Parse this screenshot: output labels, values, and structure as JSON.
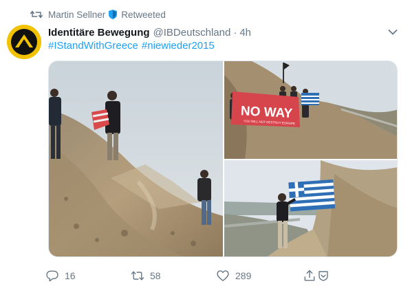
{
  "retweet_banner": {
    "user": "Martin Sellner",
    "label": "Retweeted",
    "icon": "retweet-icon",
    "badge_icon": "shield-icon"
  },
  "author": {
    "name": "Identitäre Bewegung",
    "handle": "@IBDeutschland",
    "separator": "·",
    "time": "4h",
    "avatar_icon": "lambda-logo-avatar"
  },
  "tweet": {
    "hashtags": [
      "#IStandWithGreece",
      "#niewieder2015"
    ]
  },
  "media": {
    "banner_text": "NO WAY",
    "banner_subtext": "YOU WILL NOT DESTROY EUROPE"
  },
  "actions": {
    "reply_count": "16",
    "retweet_count": "58",
    "like_count": "289"
  },
  "colors": {
    "accent": "#1da1f2",
    "muted": "#657786",
    "text": "#14171a",
    "avatar_bg": "#f2c200"
  }
}
